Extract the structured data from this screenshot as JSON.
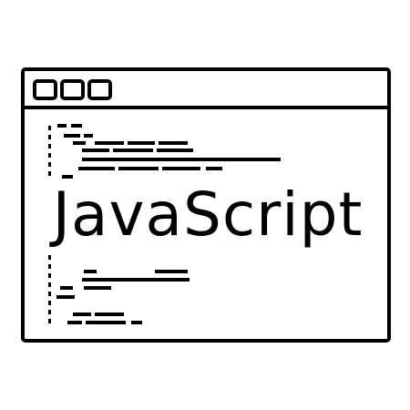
{
  "icon": {
    "name": "javascript-code-window-icon",
    "title_text": "JavaScript",
    "stroke_color": "#000000",
    "background_color": "#ffffff",
    "window_buttons": [
      "window-button-icon",
      "window-button-icon",
      "window-button-icon"
    ]
  }
}
